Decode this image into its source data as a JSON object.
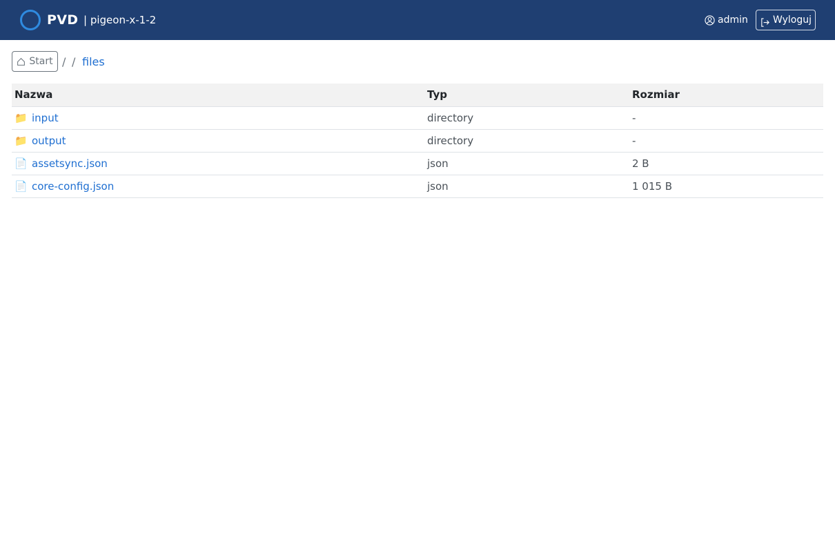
{
  "navbar": {
    "brand": "PVD",
    "host": "| pigeon-x-1-2",
    "user": "admin",
    "logout_label": "Wyloguj",
    "colors": {
      "background": "#1f3f72",
      "logo_ring": "#2f8be0"
    }
  },
  "breadcrumb": {
    "start_label": "Start",
    "separators": [
      "/",
      "/"
    ],
    "current": "files"
  },
  "table": {
    "headers": [
      "Nazwa",
      "Typ",
      "Rozmiar"
    ],
    "rows": [
      {
        "icon": "📁",
        "icon_name": "folder-icon",
        "name": "input",
        "type": "directory",
        "size": "-"
      },
      {
        "icon": "📁",
        "icon_name": "folder-icon",
        "name": "output",
        "type": "directory",
        "size": "-"
      },
      {
        "icon": "📄",
        "icon_name": "file-icon",
        "name": "assetsync.json",
        "type": "json",
        "size": "2 B"
      },
      {
        "icon": "📄",
        "icon_name": "file-icon",
        "name": "core-config.json",
        "type": "json",
        "size": "1 015 B"
      }
    ]
  },
  "colors": {
    "link": "#1f6fd1",
    "muted": "#6c757d",
    "header_bg": "#f2f2f2"
  }
}
